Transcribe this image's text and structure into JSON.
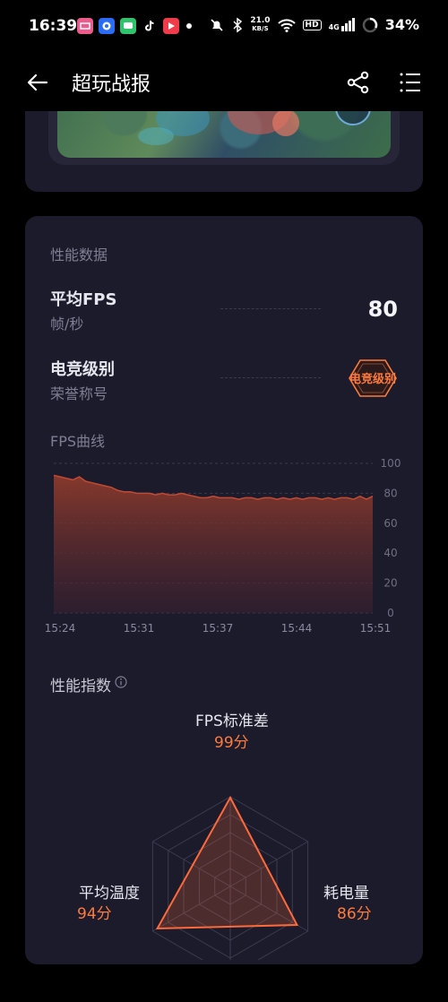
{
  "status_bar": {
    "time": "16:39",
    "network_speed_value": "21.0",
    "network_speed_unit": "KB/S",
    "hd_label": "HD",
    "signal_label": "4G",
    "battery": "34%"
  },
  "app_bar": {
    "title": "超玩战报"
  },
  "performance": {
    "section_title": "性能数据",
    "avg_fps_title": "平均FPS",
    "avg_fps_sub": "帧/秒",
    "avg_fps_value": "80",
    "esports_title": "电竞级别",
    "esports_sub": "荣誉称号",
    "esports_badge": "电竞级别"
  },
  "fps_chart": {
    "title": "FPS曲线"
  },
  "chart_data": {
    "type": "area",
    "x": [
      0,
      0.02,
      0.04,
      0.06,
      0.08,
      0.1,
      0.12,
      0.14,
      0.16,
      0.18,
      0.2,
      0.22,
      0.24,
      0.26,
      0.28,
      0.3,
      0.32,
      0.34,
      0.36,
      0.38,
      0.4,
      0.42,
      0.44,
      0.46,
      0.48,
      0.5,
      0.52,
      0.54,
      0.56,
      0.58,
      0.6,
      0.62,
      0.64,
      0.66,
      0.68,
      0.7,
      0.72,
      0.74,
      0.76,
      0.78,
      0.8,
      0.82,
      0.84,
      0.86,
      0.88,
      0.9,
      0.92,
      0.94,
      0.96,
      0.98,
      1.0
    ],
    "values": [
      92,
      91,
      90,
      89,
      91,
      88,
      87,
      86,
      85,
      84,
      82,
      81,
      81,
      80,
      80,
      80,
      79,
      80,
      79,
      79,
      80,
      79,
      78,
      77,
      77,
      78,
      77,
      77,
      77,
      76,
      77,
      77,
      76,
      77,
      77,
      76,
      77,
      76,
      77,
      76,
      77,
      77,
      76,
      77,
      76,
      77,
      77,
      76,
      78,
      76,
      78
    ],
    "x_tick_labels": [
      "15:24",
      "15:31",
      "15:37",
      "15:44",
      "15:51"
    ],
    "y_ticks": [
      0,
      20,
      40,
      60,
      80,
      100
    ],
    "ylim": [
      0,
      100
    ],
    "grid": true,
    "color": "#c24a33"
  },
  "index": {
    "title": "性能指数",
    "top_label": "FPS标准差",
    "top_score": "99分",
    "right_label": "耗电量",
    "right_score": "86分",
    "left_label": "平均温度",
    "left_score": "94分",
    "scores": [
      99,
      86,
      94
    ],
    "accent": "#ff6a3a"
  },
  "icons": {
    "back": "arrow-left-icon",
    "share": "share-icon",
    "menu": "list-menu-icon",
    "info": "info-icon"
  }
}
